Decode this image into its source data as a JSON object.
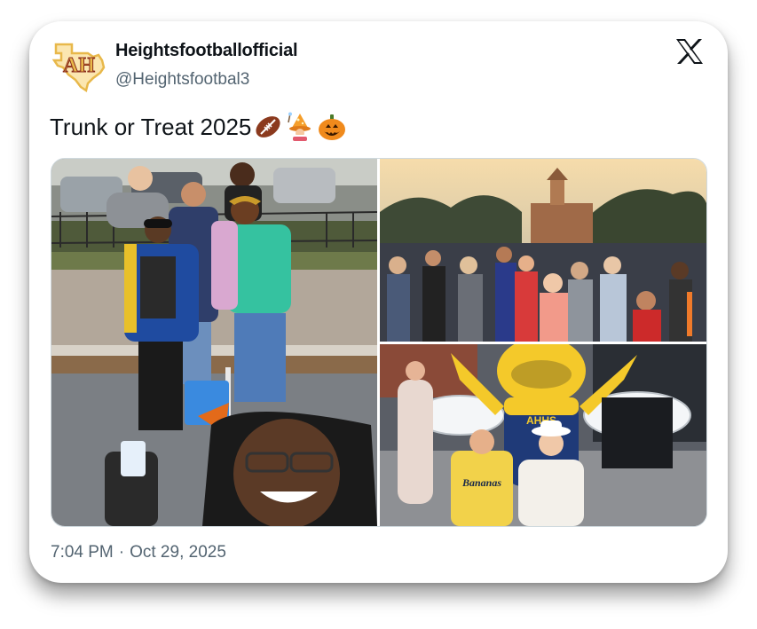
{
  "author": {
    "display_name": "Heightsfootballofficial",
    "handle": "@Heightsfootbal3",
    "avatar_icon": "texas-ah-logo-icon",
    "avatar_text": "AH"
  },
  "platform_icon": "x-logo-icon",
  "tweet": {
    "text": "Trunk or Treat 2025",
    "emojis": [
      "american-football-icon",
      "wizard-icon",
      "jack-o-lantern-icon"
    ]
  },
  "media": {
    "photos": [
      {
        "name": "group-selfie-photo"
      },
      {
        "name": "crowd-at-event-photo"
      },
      {
        "name": "mascot-with-kids-photo"
      }
    ],
    "mascot_shirt_text": "AHHS",
    "jersey_text": "Bananas"
  },
  "footer": {
    "time": "7:04 PM",
    "separator": "·",
    "date": "Oct 29, 2025"
  },
  "colors": {
    "text_primary": "#0f1419",
    "text_secondary": "#536471",
    "avatar_gold": "#e8b84a",
    "avatar_maroon": "#8a2a1a",
    "mascot_yellow": "#f4c92a",
    "mascot_navy": "#1f3a78"
  }
}
